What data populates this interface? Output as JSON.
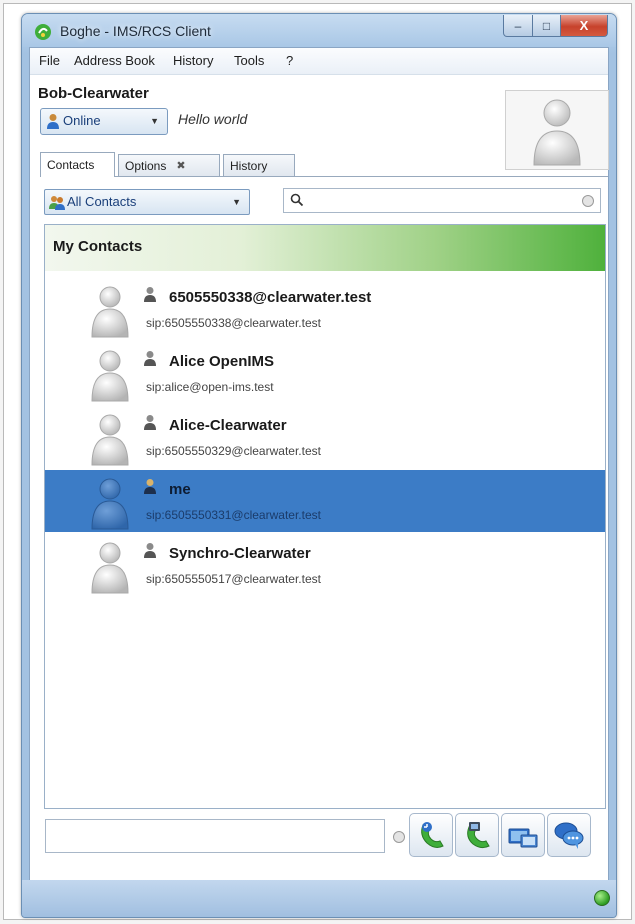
{
  "window": {
    "title": "Boghe - IMS/RCS Client",
    "controls": {
      "minimize": "–",
      "maximize": "□",
      "close": "X"
    }
  },
  "menu": [
    "File",
    "Address Book",
    "History",
    "Tools",
    "?"
  ],
  "user": {
    "name": "Bob-Clearwater",
    "status": "Online",
    "mood": "Hello world"
  },
  "tabs": [
    {
      "label": "Contacts",
      "active": true
    },
    {
      "label": "Options",
      "closable": true,
      "close_glyph": "✖"
    },
    {
      "label": "History"
    }
  ],
  "filter": {
    "selected": "All Contacts"
  },
  "search": {
    "value": "",
    "placeholder": ""
  },
  "contacts": {
    "group": "My Contacts",
    "items": [
      {
        "name": "6505550338@clearwater.test",
        "sip": "sip:6505550338@clearwater.test",
        "selected": false
      },
      {
        "name": "Alice OpenIMS",
        "sip": "sip:alice@open-ims.test",
        "selected": false
      },
      {
        "name": "Alice-Clearwater",
        "sip": "sip:6505550329@clearwater.test",
        "selected": false
      },
      {
        "name": "me",
        "sip": "sip:6505550331@clearwater.test",
        "selected": true
      },
      {
        "name": "Synchro-Clearwater",
        "sip": "sip:6505550517@clearwater.test",
        "selected": false
      }
    ]
  },
  "bottom": {
    "input_value": ""
  },
  "actions": [
    "voice-call",
    "video-call",
    "share-content",
    "chat"
  ],
  "colors": {
    "selection": "#3c7cc6",
    "group_header_end": "#4fb13c",
    "status_online": "#2e9d23"
  }
}
